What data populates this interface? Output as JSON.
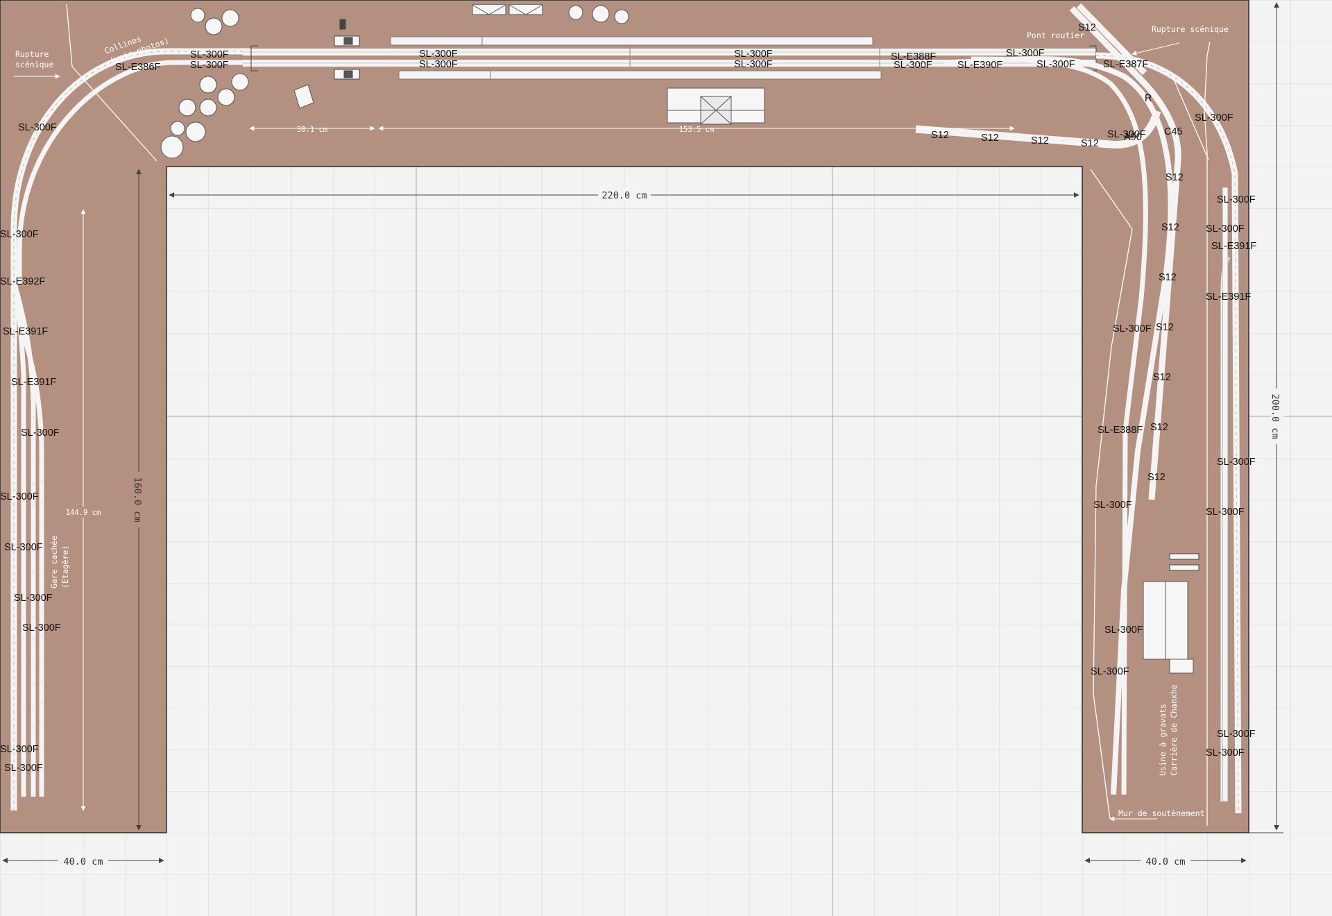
{
  "colors": {
    "background": "#f3f3f3",
    "board": "#b09080",
    "grid": "#d8d8d8",
    "track": "#f2f2f2",
    "dimension": "#444444"
  },
  "dimensions": {
    "width_top": "220.0 cm",
    "width_left": "40.0 cm",
    "width_right": "40.0 cm",
    "height_total": "200.0 cm",
    "height_left": "160.0 cm",
    "left_inner": "144.9 cm",
    "top_small": "30.1 cm",
    "top_long": "153.5 cm"
  },
  "notes": {
    "rupture_left_1": "Rupture",
    "rupture_left_2": "scénique",
    "collines_1": "Collines",
    "collines_2": "(voir photos)",
    "pont": "Pont routier",
    "rupture_right": "Rupture scénique",
    "gare_1": "Gare cachée",
    "gare_2": "(Etagère)",
    "usine_1": "Usine à gravats",
    "usine_2": "Carrière de Chanxhe",
    "mur": "Mur de soutènement"
  },
  "track_labels": {
    "top_sl300f_a": "SL-300F",
    "top_sl300f_b": "SL-300F",
    "top_sl300f_c": "SL-300F",
    "top_sl300f_d": "SL-300F",
    "top_sl300f_e": "SL-300F",
    "top_sl300f_f": "SL-300F",
    "top_e386f": "SL-E386F",
    "top_e388f": "SL-E388F",
    "top_sl300f_g": "SL-300F",
    "top_e390f": "SL-E390F",
    "top_sl300f_h": "SL-300F",
    "top_sl300f_i": "SL-300F",
    "top_e387f": "SL-E387F",
    "top_s12": "S12",
    "left_1": "SL-300F",
    "left_2": "SL-300F",
    "left_e392f": "SL-E392F",
    "left_e391f_a": "SL-E391F",
    "left_e391f_b": "SL-E391F",
    "left_3": "SL-300F",
    "left_4": "SL-300F",
    "left_5": "SL-300F",
    "left_6": "SL-300F",
    "left_7": "SL-300F",
    "left_8": "SL-300F",
    "left_9": "SL-300F",
    "siding_s12_1": "S12",
    "siding_s12_2": "S12",
    "siding_s12_3": "S12",
    "siding_s12_4": "S12",
    "r_label": "R",
    "c45": "C45",
    "a90": "A90",
    "r_sl300f_1": "SL-300F",
    "rv_s12_1": "S12",
    "rv_s12_2": "S12",
    "rv_s12_3": "S12",
    "rv_s12_4": "S12",
    "rv_s12_5": "S12",
    "rv_s12_6": "S12",
    "rv_s12_7": "S12",
    "rm_sl300f_1": "SL-300F",
    "rm_e388f": "SL-E388F",
    "rm_sl300f_2": "SL-300F",
    "rm_sl300f_3": "SL-300F",
    "rm_sl300f_4": "SL-300F",
    "ro_sl300f_1": "SL-300F",
    "ro_sl300f_2": "SL-300F",
    "ro_sl300f_3": "SL-300F",
    "ro_e391f_1": "SL-E391F",
    "ro_e391f_2": "SL-E391F",
    "ro_sl300f_4": "SL-300F",
    "ro_sl300f_5": "SL-300F",
    "ro_sl300f_6": "SL-300F",
    "ro_sl300f_7": "SL-300F",
    "ro_sl300f_8": "SL-300F"
  }
}
